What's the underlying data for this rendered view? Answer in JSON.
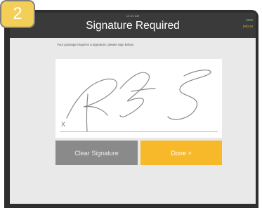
{
  "step_badge": {
    "number": "2"
  },
  "topbar": {
    "time": "10:02 AM",
    "title": "Signature Required",
    "status_right_line1": "0900",
    "status_right_line2": "(00) 04"
  },
  "content": {
    "instruction": "Your package requires a signature, please sign below.",
    "signature": {
      "x_mark": "X"
    }
  },
  "buttons": {
    "clear_label": "Clear Signature",
    "done_label": "Done >"
  },
  "colors": {
    "badge": "#f3cf57",
    "done_button": "#f7b92a",
    "clear_button": "#8a8a8a",
    "topbar": "#3a3a3a"
  }
}
